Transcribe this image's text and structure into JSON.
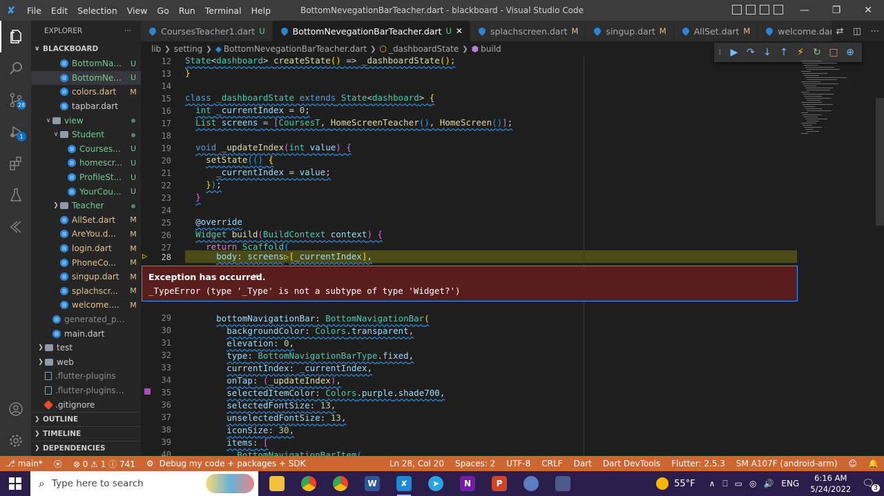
{
  "window": {
    "title": "BottomNevegationBarTeacher.dart - blackboard - Visual Studio Code",
    "menu": [
      "File",
      "Edit",
      "Selection",
      "View",
      "Go",
      "Run",
      "Terminal",
      "Help"
    ]
  },
  "activity": {
    "scm_badge": "28",
    "debug_badge": "1"
  },
  "explorer": {
    "header": "EXPLORER",
    "more": "···",
    "root": "BLACKBOARD",
    "items": [
      {
        "name": "BottomNa...",
        "dec": "U",
        "type": "dart",
        "indent": 3,
        "color": "green"
      },
      {
        "name": "BottomNe...",
        "dec": "U",
        "type": "dart",
        "indent": 3,
        "color": "green",
        "selected": true
      },
      {
        "name": "colors.dart",
        "dec": "M",
        "type": "dart",
        "indent": 3,
        "color": "yellow"
      },
      {
        "name": "tapbar.dart",
        "dec": "",
        "type": "dart",
        "indent": 3,
        "color": "none"
      },
      {
        "name": "view",
        "dec": "dot",
        "type": "folder-open",
        "indent": 2,
        "color": "green"
      },
      {
        "name": "Student",
        "dec": "dot",
        "type": "folder-open",
        "indent": 3,
        "color": "green"
      },
      {
        "name": "Courses...",
        "dec": "U",
        "type": "dart",
        "indent": 4,
        "color": "green"
      },
      {
        "name": "homescr...",
        "dec": "U",
        "type": "dart",
        "indent": 4,
        "color": "green"
      },
      {
        "name": "ProfileSt...",
        "dec": "U",
        "type": "dart",
        "indent": 4,
        "color": "green"
      },
      {
        "name": "YourCou...",
        "dec": "U",
        "type": "dart",
        "indent": 4,
        "color": "green"
      },
      {
        "name": "Teacher",
        "dec": "dot",
        "type": "folder",
        "indent": 3,
        "color": "green"
      },
      {
        "name": "AllSet.dart",
        "dec": "M",
        "type": "dart",
        "indent": 3,
        "color": "yellow"
      },
      {
        "name": "AreYou.d...",
        "dec": "M",
        "type": "dart",
        "indent": 3,
        "color": "yellow"
      },
      {
        "name": "login.dart",
        "dec": "M",
        "type": "dart",
        "indent": 3,
        "color": "yellow"
      },
      {
        "name": "PhoneCo...",
        "dec": "M",
        "type": "dart",
        "indent": 3,
        "color": "yellow"
      },
      {
        "name": "singup.dart",
        "dec": "M",
        "type": "dart",
        "indent": 3,
        "color": "yellow"
      },
      {
        "name": "splachscr...",
        "dec": "M",
        "type": "dart",
        "indent": 3,
        "color": "yellow"
      },
      {
        "name": "welcome....",
        "dec": "M",
        "type": "dart",
        "indent": 3,
        "color": "yellow"
      },
      {
        "name": "generated_plugi...",
        "dec": "",
        "type": "dart",
        "indent": 2,
        "color": "gray"
      },
      {
        "name": "main.dart",
        "dec": "",
        "type": "dart",
        "indent": 2,
        "color": "none"
      },
      {
        "name": "test",
        "dec": "",
        "type": "folder",
        "indent": 1,
        "color": "none"
      },
      {
        "name": "web",
        "dec": "",
        "type": "folder",
        "indent": 1,
        "color": "none"
      },
      {
        "name": ".flutter-plugins",
        "dec": "",
        "type": "file",
        "indent": 1,
        "color": "gray"
      },
      {
        "name": ".flutter-plugins-de...",
        "dec": "",
        "type": "file",
        "indent": 1,
        "color": "gray"
      },
      {
        "name": ".gitignore",
        "dec": "",
        "type": "git",
        "indent": 1,
        "color": "none"
      }
    ],
    "sections": [
      "OUTLINE",
      "TIMELINE",
      "DEPENDENCIES"
    ]
  },
  "tabs": [
    {
      "label": "CoursesTeacher1.dart",
      "dec": "U",
      "active": false
    },
    {
      "label": "BottomNevegationBarTeacher.dart",
      "dec": "U",
      "active": true
    },
    {
      "label": "splachscreen.dart",
      "dec": "M",
      "active": false
    },
    {
      "label": "singup.dart",
      "dec": "M",
      "active": false
    },
    {
      "label": "AllSet.dart",
      "dec": "M",
      "active": false
    },
    {
      "label": "welcome.dart",
      "dec": "M",
      "active": false
    }
  ],
  "breadcrumb": [
    "lib",
    "setting",
    "BottomNevegationBarTeacher.dart",
    "_dashboardState",
    "build"
  ],
  "exception": {
    "title": "Exception has occurred.",
    "message": "_TypeError (type '_Type' is not a subtype of type 'Widget?')"
  },
  "gutter": [
    "12",
    "13",
    "14",
    "15",
    "16",
    "17",
    "18",
    "19",
    "20",
    "21",
    "22",
    "23",
    "24",
    "25",
    "26",
    "27",
    "28",
    "29",
    "30",
    "31",
    "32",
    "33",
    "34",
    "35",
    "36",
    "37",
    "38",
    "39",
    "40"
  ],
  "current_line": "28",
  "statusbar": {
    "branch": "main*",
    "problems": "⊗ 0 ⚠ 1 ⓘ 741",
    "debug": "Debug my code + packages + SDK",
    "position": "Ln 28, Col 20",
    "spaces": "Spaces: 2",
    "encoding": "UTF-8",
    "eol": "CRLF",
    "language": "Dart",
    "devtools": "Dart DevTools",
    "flutter": "Flutter: 2.5.3",
    "device": "SM A107F (android-arm)"
  },
  "taskbar": {
    "search_placeholder": "Type here to search",
    "temperature": "55°F",
    "lang": "ENG",
    "time": "6:16 AM",
    "date": "5/24/2022",
    "notif_count": "3"
  }
}
